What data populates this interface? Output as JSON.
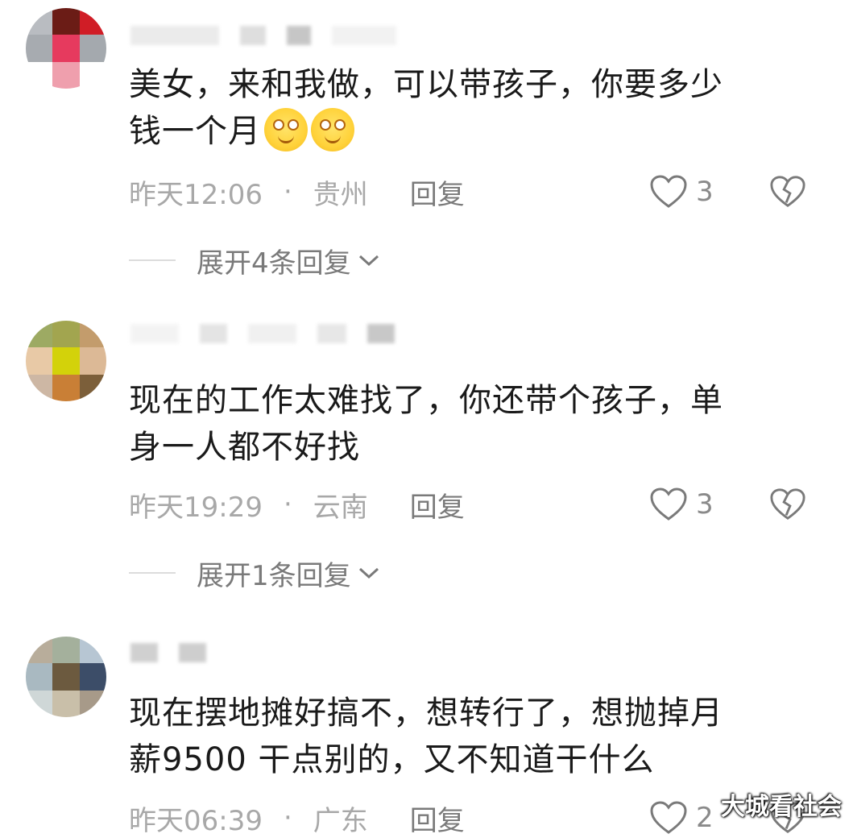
{
  "comments": [
    {
      "text_line1": "美女，来和我做，可以带孩子，你要多少",
      "text_line2": "钱一个月",
      "time": "昨天12:06",
      "dot": "·",
      "location": "贵州",
      "reply": "回复",
      "likes": "3",
      "expand": "展开4条回复",
      "avatar_colors": [
        "#b9bcc1",
        "#6b1c16",
        "#d01d26",
        "#a7abb0",
        "#e63a5e",
        "#a4a9ae",
        "#ffffff",
        "#ef9fad",
        "#ffffff"
      ],
      "emoji_count": 2
    },
    {
      "text_line1": "现在的工作太难找了，你还带个孩子，单",
      "text_line2": "身一人都不好找",
      "time": "昨天19:29",
      "dot": "·",
      "location": "云南",
      "reply": "回复",
      "likes": "3",
      "expand": "展开1条回复",
      "avatar_colors": [
        "#9daa63",
        "#a2a54f",
        "#c39c6c",
        "#e8c9a6",
        "#d3d20a",
        "#dcb996",
        "#cdb7a4",
        "#c97f36",
        "#7c5f3a"
      ]
    },
    {
      "text_line1": "现在摆地摊好搞不，想转行了，想抛掉月",
      "text_line2": "薪9500  干点别的，又不知道干什么",
      "time": "昨天06:39",
      "dot": "·",
      "location": "广东",
      "reply": "回复",
      "likes": "2",
      "avatar_colors": [
        "#b8ad9b",
        "#a4b09c",
        "#b7c6d3",
        "#a9b9c1",
        "#6c5a3f",
        "#3c4d68",
        "#cfd7d7",
        "#c9bfa9",
        "#a79a89"
      ]
    }
  ],
  "watermark": "大城看社会",
  "icons": {
    "like": "heart-outline-icon",
    "dislike": "broken-heart-icon",
    "expand": "chevron-down-icon"
  }
}
